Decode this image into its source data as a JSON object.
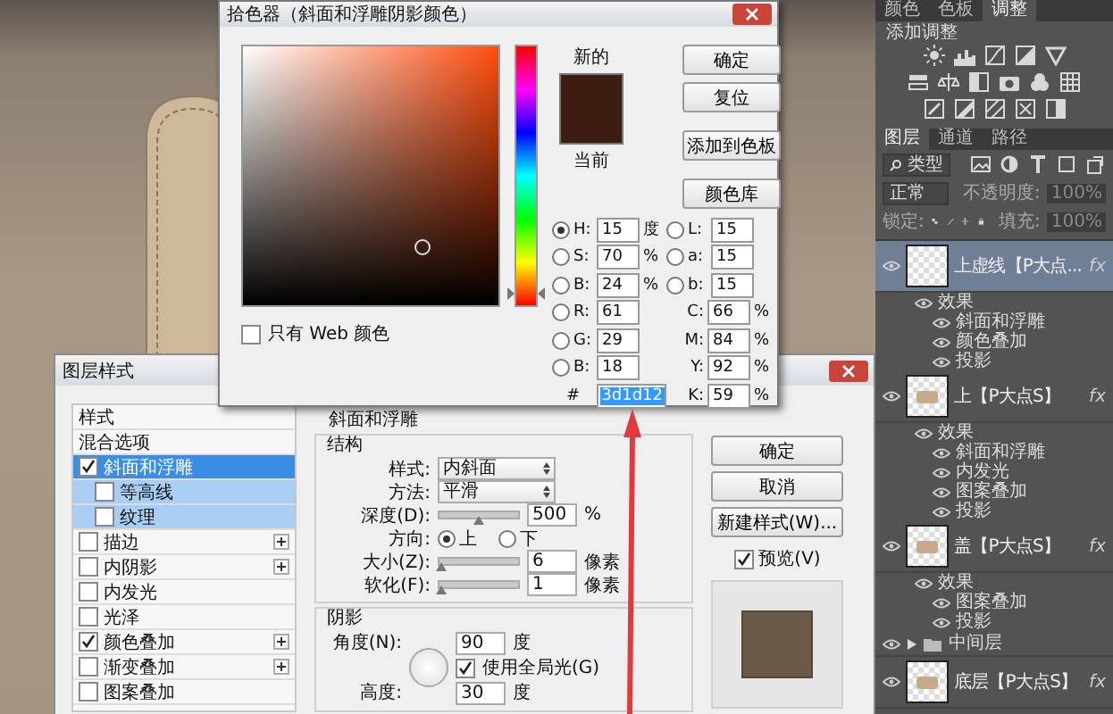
{
  "color_picker": {
    "title": "拾色器（斜面和浮雕阴影颜色）",
    "hue": {
      "level": 0.04
    },
    "new_label": "新的",
    "current_label": "当前",
    "buttons": [
      "确定",
      "复位",
      "添加到色板",
      "颜色库"
    ],
    "web_only": {
      "label": "只有 Web 颜色",
      "checked": false
    },
    "fields": [
      {
        "kind": "radio",
        "label": "H:",
        "value": "15",
        "unit": "度",
        "selected": true
      },
      {
        "kind": "radio",
        "label": "S:",
        "value": "70",
        "unit": "%",
        "selected": false
      },
      {
        "kind": "radio",
        "label": "B:",
        "value": "24",
        "unit": "%",
        "selected": false
      },
      {
        "kind": "radio",
        "label": "R:",
        "value": "61",
        "selected": false
      },
      {
        "kind": "radio",
        "label": "G:",
        "value": "29",
        "selected": false
      },
      {
        "kind": "radio",
        "label": "B:",
        "value": "18",
        "selected": false
      },
      {
        "kind": "hex",
        "label": "#",
        "value": "3d1d12"
      },
      {
        "kind": "radio",
        "label": "L:",
        "value": "15",
        "selected": false
      },
      {
        "kind": "radio",
        "label": "a:",
        "value": "15",
        "selected": false
      },
      {
        "kind": "radio",
        "label": "b:",
        "value": "15",
        "selected": false
      },
      {
        "kind": "plain",
        "label": "C:",
        "value": "66",
        "unit": "%"
      },
      {
        "kind": "plain",
        "label": "M:",
        "value": "84",
        "unit": "%"
      },
      {
        "kind": "plain",
        "label": "Y:",
        "value": "92",
        "unit": "%"
      },
      {
        "kind": "plain",
        "label": "K:",
        "value": "59",
        "unit": "%"
      }
    ]
  },
  "layer_style": {
    "title": "图层样式",
    "styles": [
      {
        "kind": "header",
        "label": "样式",
        "selected": false
      },
      {
        "kind": "header",
        "label": "混合选项",
        "selected": false
      },
      {
        "kind": "effect",
        "label": "斜面和浮雕",
        "checked": true,
        "selected": true,
        "add": false
      },
      {
        "kind": "sub",
        "label": "等高线",
        "checked": false,
        "selected": false,
        "add": false
      },
      {
        "kind": "sub",
        "label": "纹理",
        "checked": false,
        "selected": false,
        "add": false
      },
      {
        "kind": "effect",
        "label": "描边",
        "checked": false,
        "selected": false,
        "add": true
      },
      {
        "kind": "effect",
        "label": "内阴影",
        "checked": false,
        "selected": false,
        "add": true
      },
      {
        "kind": "effect",
        "label": "内发光",
        "checked": false,
        "selected": false,
        "add": false
      },
      {
        "kind": "effect",
        "label": "光泽",
        "checked": false,
        "selected": false,
        "add": false
      },
      {
        "kind": "effect",
        "label": "颜色叠加",
        "checked": true,
        "selected": false,
        "add": true
      },
      {
        "kind": "effect",
        "label": "渐变叠加",
        "checked": false,
        "selected": false,
        "add": true
      },
      {
        "kind": "effect",
        "label": "图案叠加",
        "checked": false,
        "selected": false,
        "add": false
      }
    ],
    "section_title": "斜面和浮雕",
    "structure": {
      "title": "结构",
      "rows": [
        {
          "kind": "dropdown",
          "label": "样式:",
          "value": "内斜面"
        },
        {
          "kind": "dropdown",
          "label": "方法:",
          "value": "平滑"
        },
        {
          "kind": "slider",
          "label": "深度(D):",
          "level": 0.5,
          "value": "500",
          "unit": "%"
        },
        {
          "kind": "radios",
          "label": "方向:",
          "options": [
            {
              "label": "上",
              "selected": true
            },
            {
              "label": "下",
              "selected": false
            }
          ]
        },
        {
          "kind": "slider",
          "label": "大小(Z):",
          "level": 0.03,
          "value": "6",
          "unit": "像素"
        },
        {
          "kind": "slider",
          "label": "软化(F):",
          "level": 0.03,
          "value": "1",
          "unit": "像素"
        }
      ]
    },
    "shading": {
      "title": "阴影",
      "angle": {
        "label": "角度(N):",
        "value": "90",
        "unit": "度"
      },
      "global_light": {
        "label": "使用全局光(G)",
        "checked": true
      },
      "altitude": {
        "label": "高度:",
        "value": "30",
        "unit": "度"
      }
    },
    "buttons": [
      "确定",
      "取消",
      "新建样式(W)..."
    ],
    "preview": {
      "label": "预览(V)",
      "checked": true
    }
  },
  "adjustments": {
    "tabs": [
      {
        "label": "颜色",
        "selected": false
      },
      {
        "label": "色板",
        "selected": false
      },
      {
        "label": "调整",
        "selected": true
      }
    ],
    "title": "添加调整"
  },
  "layers_panel": {
    "tabs": [
      {
        "label": "图层",
        "selected": true
      },
      {
        "label": "通道",
        "selected": false
      },
      {
        "label": "路径",
        "selected": false
      }
    ],
    "filter": "类型",
    "blend_mode": "正常",
    "opacity": {
      "label": "不透明度:",
      "value": "100%",
      "disabled": true
    },
    "lock_label": "锁定:",
    "fill": {
      "label": "填充:",
      "value": "100%",
      "disabled": true
    },
    "layers": [
      {
        "kind": "layer",
        "name": "上虚线【P大点...",
        "shape_in_thumbnail": false,
        "selected": true,
        "fx": "fx",
        "effects": {
          "label": "效果",
          "children": [
            {
              "label": "斜面和浮雕"
            },
            {
              "label": "颜色叠加"
            },
            {
              "label": "投影"
            }
          ]
        }
      },
      {
        "kind": "layer",
        "name": "上【P大点S】",
        "shape_in_thumbnail": true,
        "selected": false,
        "fx": "fx",
        "effects": {
          "label": "效果",
          "children": [
            {
              "label": "斜面和浮雕"
            },
            {
              "label": "内发光"
            },
            {
              "label": "图案叠加"
            },
            {
              "label": "投影"
            }
          ]
        }
      },
      {
        "kind": "layer",
        "name": "盖【P大点S】",
        "shape_in_thumbnail": true,
        "selected": false,
        "fx": "fx",
        "effects": {
          "label": "效果",
          "children": [
            {
              "label": "图案叠加"
            },
            {
              "label": "投影"
            }
          ]
        }
      },
      {
        "kind": "group",
        "name": "中间层",
        "expanded": false
      },
      {
        "kind": "layer",
        "name": "底层【P大点S】",
        "shape_in_thumbnail": true,
        "selected": false,
        "fx": "fx"
      }
    ]
  }
}
